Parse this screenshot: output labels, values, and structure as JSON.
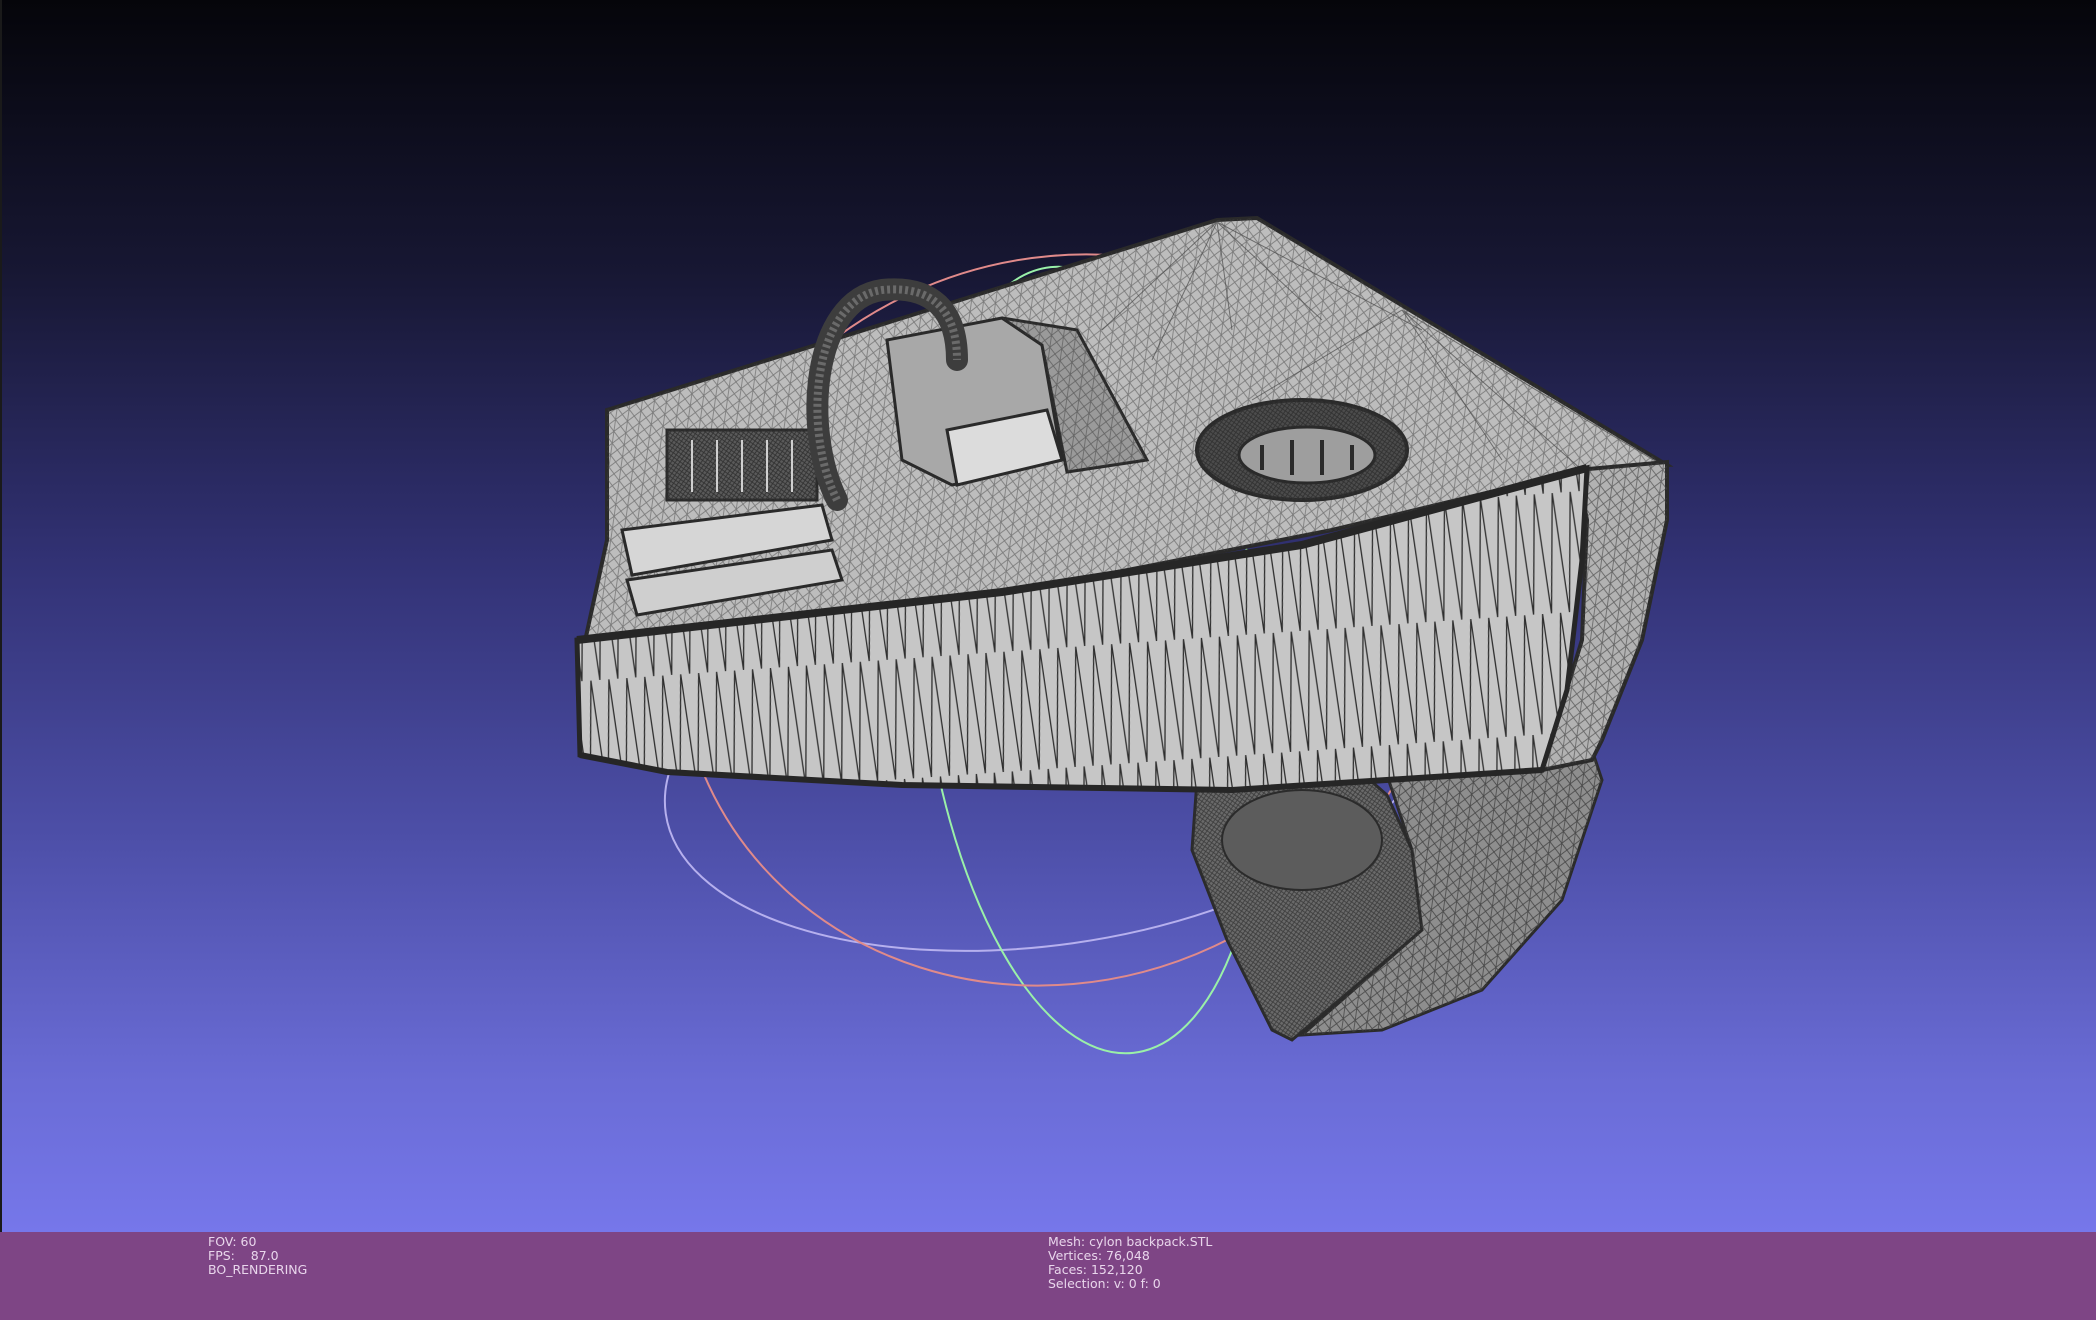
{
  "viewport": {
    "background_top": "#05050a",
    "background_bottom": "#7677ea",
    "model_fill": "#c8c8c8",
    "wire_color": "#3a3a3a",
    "trackball_colors": {
      "x_ring": "#e08a8a",
      "y_ring": "#9af0a8",
      "z_ring": "#b6b0ee"
    }
  },
  "info": {
    "fov": "FOV: 60",
    "fps": "FPS:    87.0",
    "render_mode": "BO_RENDERING",
    "mesh": "Mesh: cylon backpack.STL",
    "vertices": "Vertices: 76,048",
    "faces": "Faces: 152,120",
    "selection": "Selection: v: 0 f: 0"
  },
  "colors": {
    "infobar_bg": "#7e4585",
    "infobar_text": "#e9d6ec"
  }
}
